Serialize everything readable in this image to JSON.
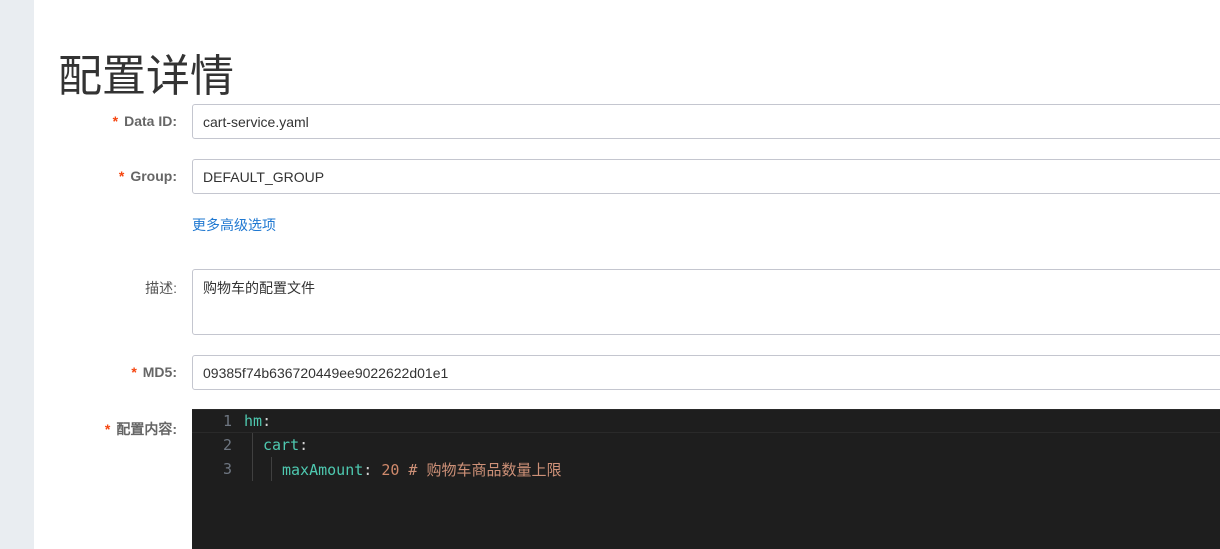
{
  "page": {
    "title": "配置详情"
  },
  "form": {
    "data_id": {
      "label": "Data ID:",
      "value": "cart-service.yaml"
    },
    "group": {
      "label": "Group:",
      "value": "DEFAULT_GROUP"
    },
    "advanced_link": "更多高级选项",
    "description": {
      "label": "描述:",
      "value": "购物车的配置文件"
    },
    "md5": {
      "label": "MD5:",
      "value": "09385f74b636720449ee9022622d01e1"
    },
    "content": {
      "label": "配置内容:"
    },
    "required_mark": "*"
  },
  "editor": {
    "lines": [
      {
        "no": "1",
        "key": "hm",
        "sep": ":",
        "value": "",
        "comment": ""
      },
      {
        "no": "2",
        "key": "cart",
        "sep": ":",
        "value": "",
        "comment": ""
      },
      {
        "no": "3",
        "key": "maxAmount",
        "sep": ":",
        "value": " 20",
        "comment": " # 购物车商品数量上限"
      }
    ]
  }
}
